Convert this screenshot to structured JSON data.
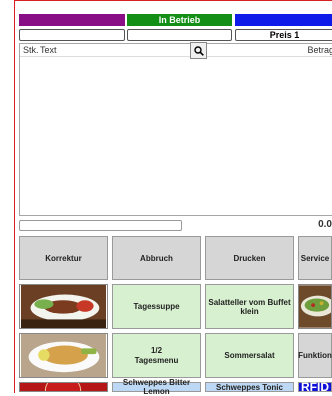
{
  "status": {
    "middle": "In Betrieb"
  },
  "fields": {
    "price_label": "Preis 1"
  },
  "ticket": {
    "col_qty": "Stk.",
    "col_text": "Text",
    "col_amount": "Betrag"
  },
  "total": "0.0",
  "buttons": {
    "row1": [
      "Korrektur",
      "Abbruch",
      "Drucken",
      "Service"
    ],
    "row2": [
      "Tagessuppe",
      "Salatteller vom Buffet klein"
    ],
    "row3": [
      "1/2",
      "Tagesmenu",
      "Sommersalat",
      "Funktion"
    ],
    "row4": [
      "Schweppes Bitter Lemon",
      "Schweppes Tonic",
      "RFID"
    ]
  },
  "icons": {
    "search": "magnifier-icon"
  },
  "colors": {
    "purple": "#880f86",
    "green": "#148f16",
    "blue": "#0f1be8",
    "rfid": "#1010d8"
  }
}
